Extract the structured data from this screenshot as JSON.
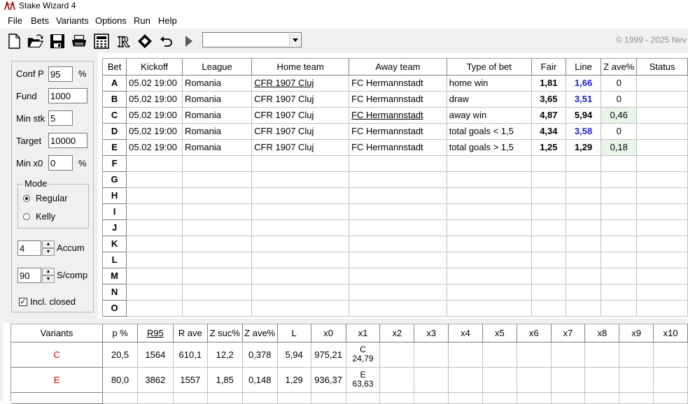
{
  "window": {
    "title": "Stake Wizard 4"
  },
  "menu": [
    "File",
    "Bets",
    "Variants",
    "Options",
    "Run",
    "Help"
  ],
  "toolbar": {
    "icons": [
      "new-file-icon",
      "open-folder-icon",
      "save-icon",
      "print-icon",
      "calculator-icon",
      "r-icon",
      "diamond-icon",
      "undo-icon",
      "run-icon"
    ],
    "variant_select_value": "",
    "copyright": "© 1999 - 2025 Nev"
  },
  "settings": {
    "conf_p_label": "Conf P",
    "conf_p_value": "95",
    "conf_p_unit": "%",
    "fund_label": "Fund",
    "fund_value": "1000",
    "min_stk_label": "Min stk",
    "min_stk_value": "5",
    "target_label": "Target",
    "target_value": "10000",
    "min_x0_label": "Min x0",
    "min_x0_value": "0",
    "min_x0_unit": "%",
    "mode_label": "Mode",
    "mode_regular": "Regular",
    "mode_kelly": "Kelly",
    "accum_value": "4",
    "accum_label": "Accum",
    "scomp_value": "90",
    "scomp_label": "S/comp",
    "incl_closed_label": "Incl. closed"
  },
  "bets": {
    "headers": [
      "Bet",
      "Kickoff",
      "League",
      "Home team",
      "Away team",
      "Type of bet",
      "Fair",
      "Line",
      "Z ave%",
      "Status"
    ],
    "rows": [
      {
        "bet": "A",
        "kickoff": "05.02 19:00",
        "league": "Romania",
        "home": "CFR 1907 Cluj",
        "away": "FC Hermannstadt",
        "type": "home win",
        "fair": "1,81",
        "line": "1,66",
        "zave": "0",
        "status": ""
      },
      {
        "bet": "B",
        "kickoff": "05.02 19:00",
        "league": "Romania",
        "home": "CFR 1907 Cluj",
        "away": "FC Hermannstadt",
        "type": "draw",
        "fair": "3,65",
        "line": "3,51",
        "zave": "0",
        "status": ""
      },
      {
        "bet": "C",
        "kickoff": "05.02 19:00",
        "league": "Romania",
        "home": "CFR 1907 Cluj",
        "away": "FC Hermannstadt",
        "type": "away win",
        "fair": "4,87",
        "line": "5,94",
        "zave": "0,46",
        "status": ""
      },
      {
        "bet": "D",
        "kickoff": "05.02 19:00",
        "league": "Romania",
        "home": "CFR 1907 Cluj",
        "away": "FC Hermannstadt",
        "type": "total goals < 1,5",
        "fair": "4,34",
        "line": "3,58",
        "zave": "0",
        "status": ""
      },
      {
        "bet": "E",
        "kickoff": "05.02 19:00",
        "league": "Romania",
        "home": "CFR 1907 Cluj",
        "away": "FC Hermannstadt",
        "type": "total goals > 1,5",
        "fair": "1,25",
        "line": "1,29",
        "zave": "0,18",
        "status": ""
      },
      {
        "bet": "F"
      },
      {
        "bet": "G"
      },
      {
        "bet": "H"
      },
      {
        "bet": "I"
      },
      {
        "bet": "J"
      },
      {
        "bet": "K"
      },
      {
        "bet": "L"
      },
      {
        "bet": "M"
      },
      {
        "bet": "N"
      },
      {
        "bet": "O"
      }
    ]
  },
  "variants": {
    "headers": [
      "Variants",
      "p %",
      "R95",
      "R ave",
      "Z suc%",
      "Z ave%",
      "L",
      "x0",
      "x1",
      "x2",
      "x3",
      "x4",
      "x5",
      "x6",
      "x7",
      "x8",
      "x9",
      "x10"
    ],
    "rows": [
      {
        "name": "C",
        "p": "20,5",
        "r95": "1564",
        "rave": "610,1",
        "zsuc": "12,2",
        "zave": "0,378",
        "l": "5,94",
        "x0": "975,21",
        "x1_bet": "C",
        "x1_val": "24,79"
      },
      {
        "name": "E",
        "p": "80,0",
        "r95": "3862",
        "rave": "1557",
        "zsuc": "1,85",
        "zave": "0,148",
        "l": "1,29",
        "x0": "936,37",
        "x1_bet": "E",
        "x1_val": "63,63"
      }
    ]
  },
  "colors": {
    "accent_blue": "#1f1fd0",
    "variant_red": "#d00000",
    "positive_green": "#e8f5e8"
  }
}
